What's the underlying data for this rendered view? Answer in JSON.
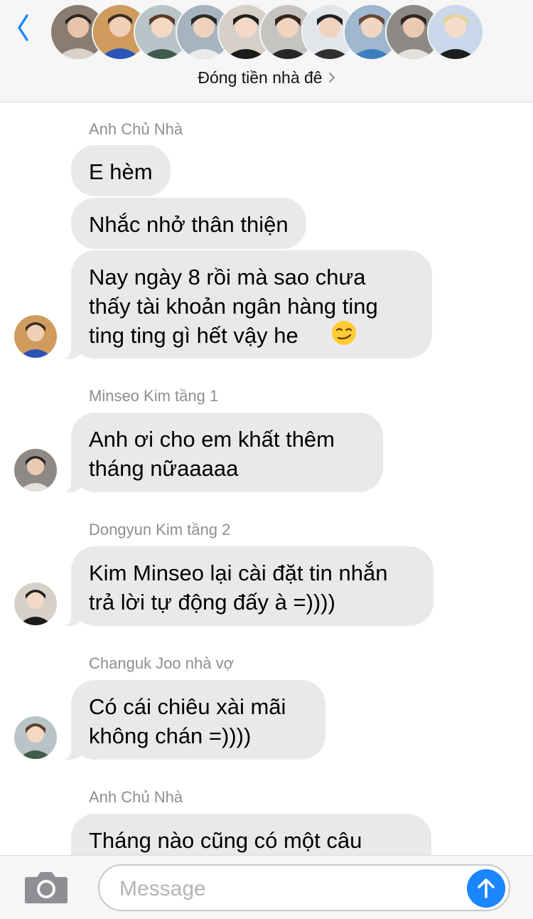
{
  "header": {
    "back_icon": "chevron-left-icon",
    "group_name": "Đóng tiền nhà đê",
    "group_chevron_icon": "chevron-right-icon",
    "participant_count": 10
  },
  "messages": [
    {
      "sender": "Anh Chủ Nhà",
      "lines": [
        "E hèm",
        "Nhắc nhở thân thiện",
        "Nay ngày 8 rồi mà sao chưa\nthấy tài khoản ngân hàng ting\nting ting gì hết vậy he"
      ],
      "emoji": "smirking-face"
    },
    {
      "sender": "Minseo Kim tầng 1",
      "lines": [
        "Anh ơi cho em khất thêm\ntháng nữaaaaa"
      ]
    },
    {
      "sender": "Dongyun Kim tầng 2",
      "lines": [
        "Kim Minseo lại cài đặt tin nhắn\ntrả lời tự động đấy à =))))"
      ]
    },
    {
      "sender": "Changuk Joo nhà vợ",
      "lines": [
        "Có cái chiêu xài mãi\nkhông chán =))))"
      ]
    },
    {
      "sender": "Anh Chủ Nhà",
      "lines": [
        "Tháng nào cũng có một câu"
      ]
    }
  ],
  "input": {
    "placeholder": "Message",
    "value": "",
    "camera_icon": "camera-icon",
    "send_icon": "arrow-up-icon"
  },
  "colors": {
    "accent": "#1a86ff",
    "bubble": "#e9e9eb",
    "sender_text": "#8e8e93",
    "header_bg": "#f6f6f6"
  }
}
